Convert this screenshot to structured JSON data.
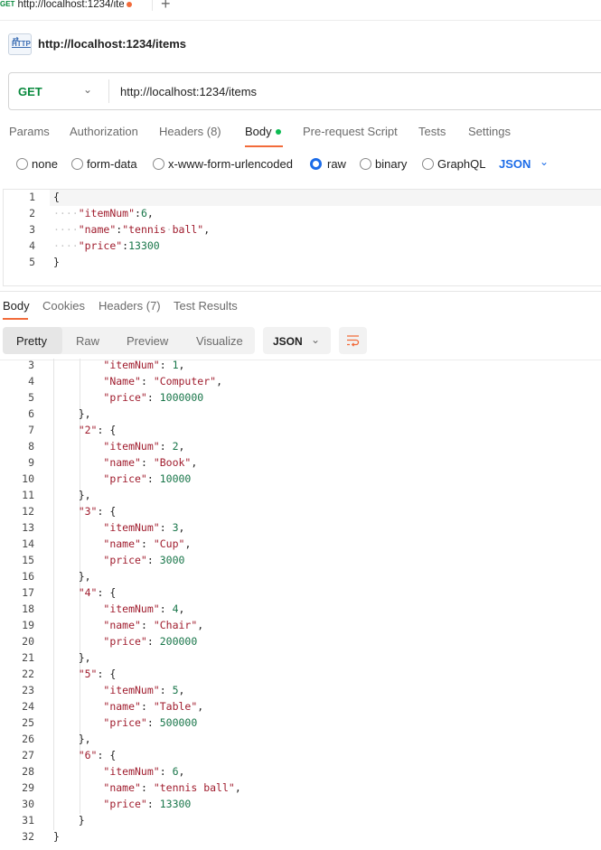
{
  "tab": {
    "method": "GET",
    "title": "http://localhost:1234/ite"
  },
  "header": {
    "title": "http://localhost:1234/items",
    "icon": "http-icon"
  },
  "urlbar": {
    "method": "GET",
    "url": "http://localhost:1234/items"
  },
  "request_tabs": [
    "Params",
    "Authorization",
    "Headers (8)",
    "Body",
    "Pre-request Script",
    "Tests",
    "Settings"
  ],
  "body_modes": [
    "none",
    "form-data",
    "x-www-form-urlencoded",
    "raw",
    "binary",
    "GraphQL"
  ],
  "selected_body_mode": "raw",
  "raw_format": "JSON",
  "request_body": {
    "line_numbers": [
      "1",
      "2",
      "3",
      "4",
      "5"
    ],
    "lines": [
      "{",
      "    \"itemNum\":6,",
      "    \"name\":\"tennis ball\",",
      "    \"price\":13300",
      "}"
    ]
  },
  "response_tabs": [
    "Body",
    "Cookies",
    "Headers (7)",
    "Test Results"
  ],
  "view_modes": [
    "Pretty",
    "Raw",
    "Preview",
    "Visualize"
  ],
  "response_format": "JSON",
  "response_body": {
    "line_numbers": [
      "3",
      "4",
      "5",
      "6",
      "7",
      "8",
      "9",
      "10",
      "11",
      "12",
      "13",
      "14",
      "15",
      "16",
      "17",
      "18",
      "19",
      "20",
      "21",
      "22",
      "23",
      "24",
      "25",
      "26",
      "27",
      "28",
      "29",
      "30",
      "31",
      "32"
    ],
    "lines": [
      "        \"itemNum\": 1,",
      "        \"Name\": \"Computer\",",
      "        \"price\": 1000000",
      "    },",
      "    \"2\": {",
      "        \"itemNum\": 2,",
      "        \"name\": \"Book\",",
      "        \"price\": 10000",
      "    },",
      "    \"3\": {",
      "        \"itemNum\": 3,",
      "        \"name\": \"Cup\",",
      "        \"price\": 3000",
      "    },",
      "    \"4\": {",
      "        \"itemNum\": 4,",
      "        \"name\": \"Chair\",",
      "        \"price\": 200000",
      "    },",
      "    \"5\": {",
      "        \"itemNum\": 5,",
      "        \"name\": \"Table\",",
      "        \"price\": 500000",
      "    },",
      "    \"6\": {",
      "        \"itemNum\": 6,",
      "        \"name\": \"tennis ball\",",
      "        \"price\": 13300",
      "    }",
      "}"
    ]
  },
  "colors": {
    "accent": "#f26b3a",
    "get": "#0a8a3e",
    "link": "#1c6ce8",
    "key": "#a01d2e",
    "number": "#19764a"
  }
}
